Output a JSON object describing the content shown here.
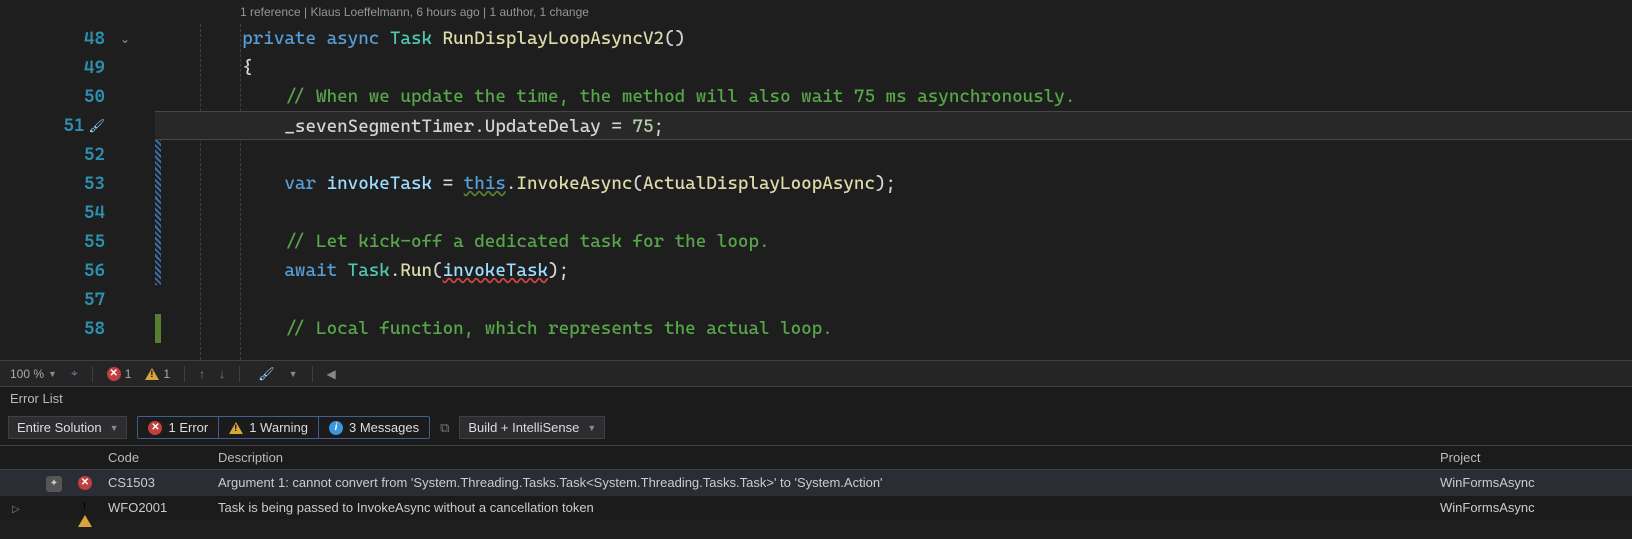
{
  "codelens": "1 reference | Klaus Loeffelmann, 6 hours ago | 1 author, 1 change",
  "lines": [
    {
      "num": "48"
    },
    {
      "num": "49"
    },
    {
      "num": "50"
    },
    {
      "num": "51"
    },
    {
      "num": "52"
    },
    {
      "num": "53"
    },
    {
      "num": "54"
    },
    {
      "num": "55"
    },
    {
      "num": "56"
    },
    {
      "num": "57"
    },
    {
      "num": "58"
    }
  ],
  "code": {
    "l48_kw1": "private",
    "l48_kw2": "async",
    "l48_type": "Task",
    "l48_method": "RunDisplayLoopAsyncV2",
    "l48_paren": "()",
    "l49": "{",
    "l50_comment": "// When we update the time, the method will also wait 75 ms asynchronously.",
    "l51_field": "_sevenSegmentTimer",
    "l51_dot": ".",
    "l51_prop": "UpdateDelay",
    "l51_eq": " = ",
    "l51_num": "75",
    "l51_semi": ";",
    "l53_var": "var",
    "l53_name": "invokeTask",
    "l53_eq": " = ",
    "l53_this": "this",
    "l53_dot": ".",
    "l53_invoke": "InvokeAsync",
    "l53_open": "(",
    "l53_arg": "ActualDisplayLoopAsync",
    "l53_close": ");",
    "l55_comment": "// Let kick-off a dedicated task for the loop.",
    "l56_await": "await",
    "l56_task": "Task",
    "l56_dot": ".",
    "l56_run": "Run",
    "l56_open": "(",
    "l56_arg": "invokeTask",
    "l56_close": ");",
    "l58_comment": "// Local function, which represents the actual loop."
  },
  "status": {
    "zoom": "100 %",
    "errors": "1",
    "warnings": "1"
  },
  "errlist": {
    "title": "Error List",
    "scope": "Entire Solution",
    "errFilter": "1 Error",
    "warnFilter": "1 Warning",
    "msgFilter": "3 Messages",
    "source": "Build + IntelliSense",
    "cols": {
      "code": "Code",
      "desc": "Description",
      "project": "Project"
    },
    "rows": [
      {
        "kind": "error",
        "code": "CS1503",
        "desc": "Argument 1: cannot convert from 'System.Threading.Tasks.Task<System.Threading.Tasks.Task>' to 'System.Action'",
        "project": "WinFormsAsync"
      },
      {
        "kind": "warning",
        "code": "WFO2001",
        "desc": "Task is being passed to InvokeAsync without a cancellation token",
        "project": "WinFormsAsync"
      }
    ]
  }
}
